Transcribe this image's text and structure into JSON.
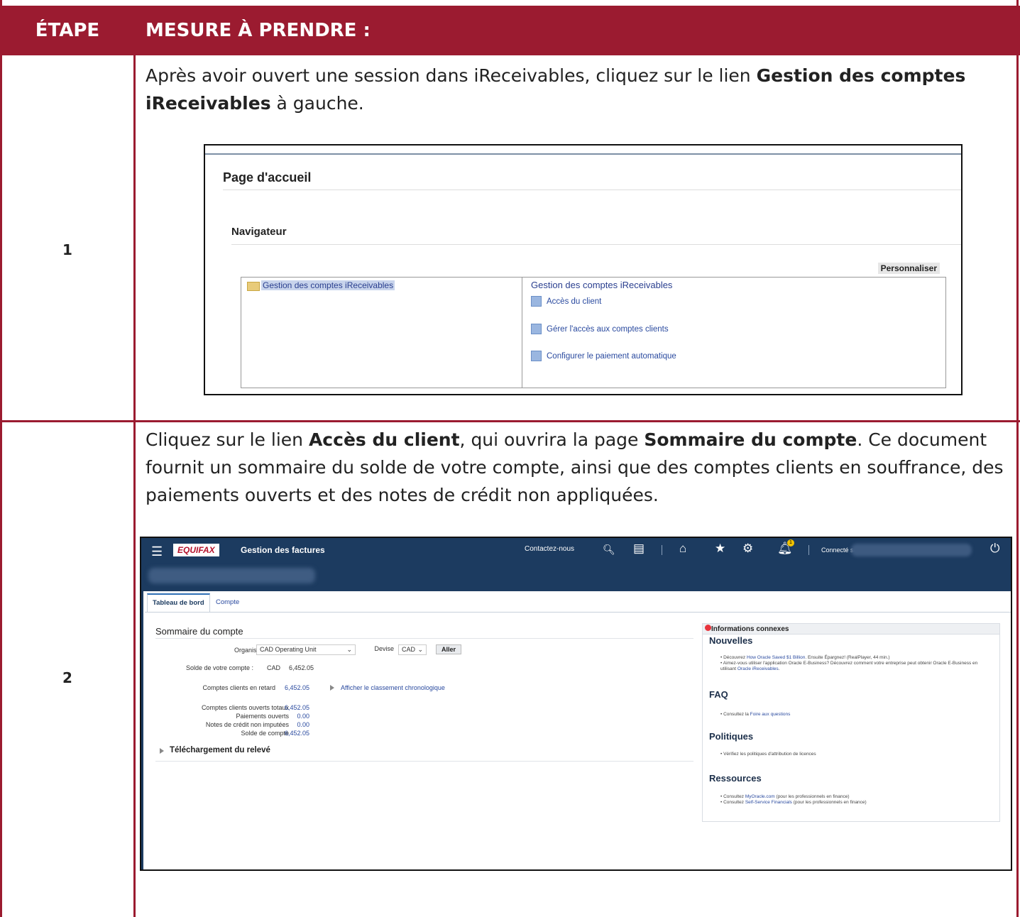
{
  "header": {
    "col_step": "ÉTAPE",
    "col_action": "MESURE À PRENDRE :"
  },
  "steps": [
    {
      "number": "1",
      "text_before": "Après avoir ouvert une session dans iReceivables, cliquez sur le lien ",
      "bold1": "Gestion des comptes iReceivables",
      "text_after": " à gauche."
    },
    {
      "number": "2",
      "text_before": "Cliquez sur le lien ",
      "bold1": "Accès du client",
      "text_mid": ", qui ouvrira la page ",
      "bold2": "Sommaire du compte",
      "text_after": ". Ce document fournit un sommaire du solde de votre compte, ainsi que des comptes clients en souffrance, des paiements ouverts et des notes de crédit non appliquées."
    }
  ],
  "screenshot1": {
    "page_title": "Page d'accueil",
    "navigator_title": "Navigateur",
    "personalize": "Personnaliser",
    "left_item": "Gestion des comptes iReceivables",
    "right_title": "Gestion des comptes iReceivables",
    "right_items": [
      "Accès du client",
      "Gérer l'accès aux comptes clients",
      "Configurer le paiement automatique"
    ]
  },
  "screenshot2": {
    "brand": "EQUIFAX",
    "app_title": "Gestion des factures",
    "contact": "Contactez-nous",
    "connected": "Connecté sous",
    "notification_count": "1",
    "tabs": [
      "Tableau de bord",
      "Compte"
    ],
    "summary_title": "Sommaire du compte",
    "org_label": "Organisation",
    "org_value": "CAD Operating Unit",
    "currency_label": "Devise",
    "currency_value": "CAD",
    "go_button": "Aller",
    "balance_label": "Solde de votre compte :",
    "balance_currency": "CAD",
    "balance_value": "6,452.05",
    "late_label": "Comptes clients en retard",
    "late_value": "6,452.05",
    "aging_link": "Afficher le classement chronologique",
    "rows": [
      {
        "label": "Comptes clients ouverts totaux",
        "value": "6,452.05"
      },
      {
        "label": "Paiements ouverts",
        "value": "0.00"
      },
      {
        "label": "Notes de crédit non imputées",
        "value": "0.00"
      },
      {
        "label": "Solde de compte",
        "value": "6,452.05"
      }
    ],
    "download": "Téléchargement du relevé",
    "related_title": "Informations connexes",
    "news_title": "Nouvelles",
    "news_1_pre": "Découvrez ",
    "news_1_link": "How Oracle Saved $1 Billion",
    "news_1_post": ". Ensuite Épargnez! (RealPlayer, 44 min.)",
    "news_2_pre": "Aimez-vous utiliser l'application Oracle E-Business? Découvrez comment votre entreprise peut obtenir Oracle E-Business en utilisant ",
    "news_2_link": "Oracle iReceivables",
    "news_2_post": ".",
    "faq_title": "FAQ",
    "faq_pre": "Consultez la ",
    "faq_link": "Foire aux questions",
    "policies_title": "Politiques",
    "policies_text": "Vérifiez les politiques d'attribution de licences",
    "resources_title": "Ressources",
    "res_1_pre": "Consultez ",
    "res_1_link": "MyOracle.com",
    "res_1_post": " (pour les professionnels en finance)",
    "res_2_pre": "Consultez ",
    "res_2_link": "Self-Service Financials",
    "res_2_post": " (pour les professionnels en finance)"
  }
}
